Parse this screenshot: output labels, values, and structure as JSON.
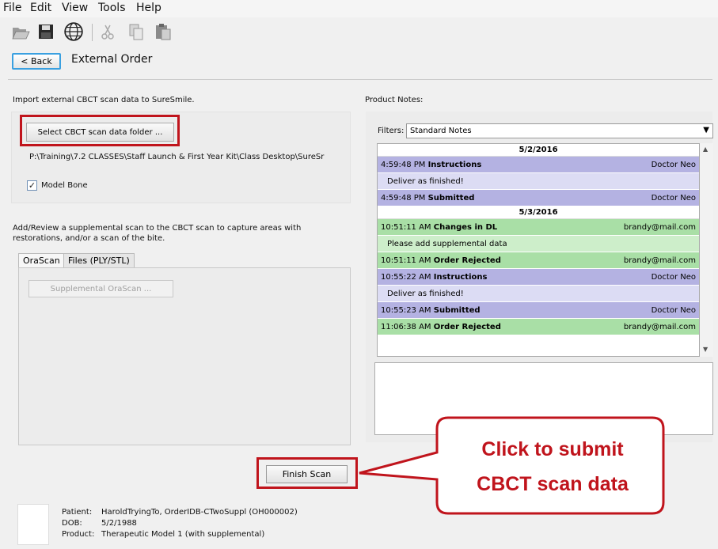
{
  "menu": [
    "File",
    "Edit",
    "View",
    "Tools",
    "Help"
  ],
  "header": {
    "back_label": "< Back",
    "title": "External Order"
  },
  "import": {
    "heading": "Import external CBCT scan data to SureSmile.",
    "select_button": "Select CBCT scan data folder ...",
    "path": "P:\\Training\\7.2 CLASSES\\Staff Launch & First Year Kit\\Class Desktop\\SureSr",
    "model_bone_check": "✓",
    "model_bone_label": "Model Bone"
  },
  "supplemental": {
    "heading_line1": "Add/Review a supplemental scan to the CBCT scan to capture areas with",
    "heading_line2": "restorations, and/or a scan of the bite.",
    "tabs": [
      "OraScan",
      "Files (PLY/STL)"
    ],
    "button": "Supplemental OraScan ..."
  },
  "notes": {
    "heading": "Product Notes:",
    "filter_label": "Filters:",
    "filter_value": "Standard Notes",
    "dropdown_arrow": "▼",
    "scroll_up": "▲",
    "scroll_down": "▼",
    "dates": [
      "5/2/2016",
      "5/3/2016"
    ],
    "entries": [
      {
        "time": "4:59:48 PM",
        "type": "Instructions",
        "author": "Doctor Neo",
        "body": "Deliver as finished!"
      },
      {
        "time": "4:59:48 PM",
        "type": "Submitted",
        "author": "Doctor Neo"
      },
      {
        "time": "10:51:11 AM",
        "type": "Changes in DL",
        "author": "brandy@mail.com",
        "body": "Please add supplemental data"
      },
      {
        "time": "10:51:11 AM",
        "type": "Order Rejected",
        "author": "brandy@mail.com"
      },
      {
        "time": "10:55:22 AM",
        "type": "Instructions",
        "author": "Doctor Neo",
        "body": "Deliver as finished!"
      },
      {
        "time": "10:55:23 AM",
        "type": "Submitted",
        "author": "Doctor Neo"
      },
      {
        "time": "11:06:38 AM",
        "type": "Order Rejected",
        "author": "brandy@mail.com"
      }
    ]
  },
  "finish_button": "Finish Scan",
  "callout": {
    "line1": "Click to submit",
    "line2": "CBCT scan data"
  },
  "footer": {
    "patient_label": "Patient:",
    "patient_value": "HaroldTryingTo, OrderIDB-CTwoSuppl (OH000002)",
    "dob_label": "DOB:",
    "dob_value": "5/2/1988",
    "product_label": "Product:",
    "product_value": "Therapeutic Model 1 (with supplemental)"
  },
  "colors": {
    "highlight_red": "#c0141c",
    "note_purple": "#b4b2e2",
    "note_green": "#a9dfa6",
    "back_border": "#3aa0e0"
  },
  "icons": [
    "open-folder-icon",
    "save-icon",
    "globe-icon",
    "cut-icon",
    "copy-icon",
    "paste-icon"
  ]
}
